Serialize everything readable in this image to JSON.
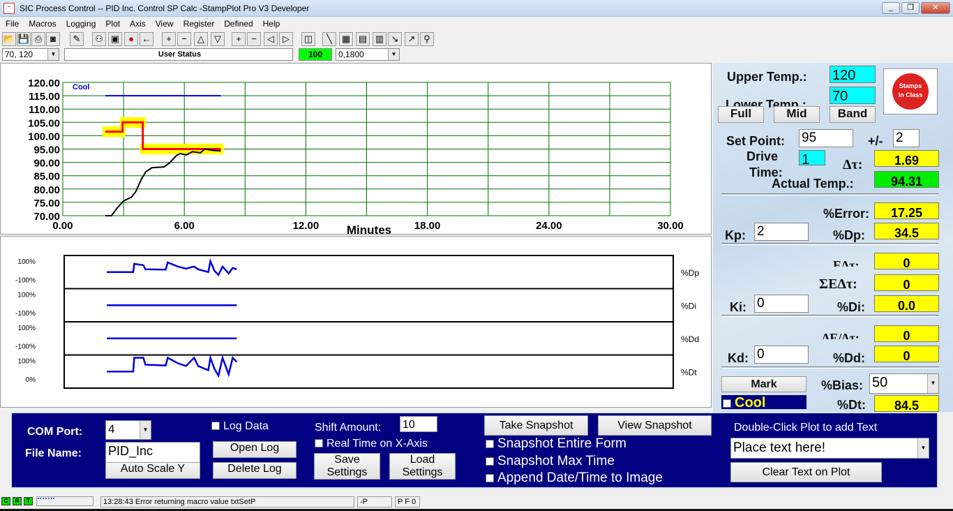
{
  "window": {
    "title": "SIC Process Control -- PID Inc. Control SP Calc -StampPlot Pro V3 Developer"
  },
  "menu": [
    "File",
    "Macros",
    "Logging",
    "Plot",
    "Axis",
    "View",
    "Register",
    "Defined",
    "Help"
  ],
  "toolbar": {
    "icons": [
      "open-icon",
      "save-icon",
      "print-icon",
      "camera-icon",
      "wand-icon",
      "connect-icon",
      "monitor-icon",
      "stop-icon",
      "back-arrow-icon",
      "plus-icon",
      "minus-icon",
      "up-icon",
      "down-icon",
      "plus-icon",
      "minus-icon",
      "left-icon",
      "right-icon",
      "clock-icon",
      "pen-icon",
      "chart-icon",
      "note-icon",
      "calc-icon",
      "probe-icon",
      "graph-icon",
      "wrench-icon"
    ]
  },
  "controls": {
    "y_range": "70, 120",
    "user_status": "User Status",
    "value_indicator": "100",
    "x_range": "0,1800"
  },
  "chart_data": [
    {
      "type": "line",
      "x_label": "Minutes",
      "xlim": [
        0,
        30
      ],
      "ylim": [
        70,
        120
      ],
      "x_ticks": [
        "0.00",
        "6.00",
        "12.00",
        "18.00",
        "24.00",
        "30.00"
      ],
      "y_ticks": [
        "70.00",
        "75.00",
        "80.00",
        "85.00",
        "90.00",
        "95.00",
        "100.00",
        "105.00",
        "110.00",
        "115.00",
        "120.00"
      ],
      "grid": true,
      "annotation": "Cool",
      "series": [
        {
          "color": "#0000dd",
          "points": [
            [
              2.1,
              115
            ],
            [
              7.8,
              115
            ]
          ]
        },
        {
          "color": "#ffff00",
          "band": 2,
          "points": [
            [
              2.1,
              101.5
            ],
            [
              2.95,
              101.5
            ],
            [
              2.95,
              105
            ],
            [
              3.95,
              105
            ],
            [
              3.95,
              95
            ],
            [
              7.8,
              95
            ]
          ]
        },
        {
          "color": "#ff0000",
          "points": [
            [
              2.1,
              101.5
            ],
            [
              2.95,
              101.5
            ],
            [
              2.95,
              105
            ],
            [
              3.95,
              105
            ],
            [
              3.95,
              95
            ],
            [
              7.8,
              95
            ]
          ]
        },
        {
          "color": "#000000",
          "points": [
            [
              2.1,
              70
            ],
            [
              2.4,
              70
            ],
            [
              2.7,
              73
            ],
            [
              3.0,
              75.5
            ],
            [
              3.4,
              77
            ],
            [
              3.6,
              79
            ],
            [
              3.9,
              84
            ],
            [
              4.1,
              86.5
            ],
            [
              4.4,
              88
            ],
            [
              5.0,
              88.3
            ],
            [
              5.3,
              90
            ],
            [
              5.6,
              92.5
            ],
            [
              5.8,
              93.3
            ],
            [
              6.1,
              92.8
            ],
            [
              6.4,
              94
            ],
            [
              6.8,
              93.6
            ],
            [
              7.0,
              95
            ],
            [
              7.4,
              94.5
            ],
            [
              7.8,
              94.3
            ]
          ]
        }
      ]
    },
    {
      "type": "line",
      "strips": [
        {
          "name": "%Dp",
          "top_label": "100%",
          "bottom_label": "-100%",
          "ylim": [
            -100,
            100
          ],
          "points": [
            [
              2.1,
              0
            ],
            [
              3.4,
              0
            ],
            [
              3.45,
              60
            ],
            [
              3.9,
              50
            ],
            [
              4.0,
              20
            ],
            [
              5.0,
              18
            ],
            [
              5.1,
              70
            ],
            [
              5.6,
              40
            ],
            [
              6.0,
              25
            ],
            [
              6.4,
              40
            ],
            [
              6.6,
              20
            ],
            [
              7.1,
              0
            ],
            [
              7.2,
              80
            ],
            [
              7.4,
              10
            ],
            [
              7.6,
              -20
            ],
            [
              7.8,
              40
            ],
            [
              8.1,
              -10
            ],
            [
              8.3,
              30
            ],
            [
              8.5,
              20
            ]
          ]
        },
        {
          "name": "%Di",
          "top_label": "100%",
          "bottom_label": "-100%",
          "ylim": [
            -100,
            100
          ],
          "points": [
            [
              2.1,
              0
            ],
            [
              8.5,
              0
            ]
          ]
        },
        {
          "name": "%Dd",
          "top_label": "100%",
          "bottom_label": "-100%",
          "ylim": [
            -100,
            100
          ],
          "points": [
            [
              2.1,
              0
            ],
            [
              8.5,
              0
            ]
          ]
        },
        {
          "name": "%Dt",
          "top_label": "100%",
          "bottom_label": "0%",
          "ylim": [
            0,
            100
          ],
          "points": [
            [
              2.1,
              50
            ],
            [
              3.4,
              50
            ],
            [
              3.45,
              100
            ],
            [
              3.9,
              100
            ],
            [
              4.0,
              75
            ],
            [
              5.0,
              72
            ],
            [
              5.1,
              100
            ],
            [
              5.6,
              80
            ],
            [
              6.0,
              70
            ],
            [
              6.4,
              100
            ],
            [
              6.6,
              70
            ],
            [
              7.1,
              55
            ],
            [
              7.2,
              100
            ],
            [
              7.4,
              60
            ],
            [
              7.6,
              35
            ],
            [
              7.8,
              100
            ],
            [
              8.1,
              40
            ],
            [
              8.3,
              100
            ],
            [
              8.5,
              85
            ]
          ]
        }
      ]
    }
  ],
  "right_panel": {
    "upper_temp_label": "Upper Temp.:",
    "upper_temp": "120",
    "lower_temp_label": "Lower Temp.:",
    "lower_temp": "70",
    "logo_text": "Stamps in Class",
    "full": "Full",
    "mid": "Mid",
    "band": "Band",
    "set_point_label": "Set Point:",
    "set_point": "95",
    "pm_label": "+/-",
    "pm": "2",
    "drive_time_label1": "Drive",
    "drive_time_label2": "Time:",
    "drive_time": "1",
    "dt_label": "Δτ:",
    "dt": "1.69",
    "actual_label": "Actual Temp.:",
    "actual": "94.31",
    "error_label": "%Error:",
    "error": "17.25",
    "kp_label": "Kp:",
    "kp": "2",
    "dp_label": "%Dp:",
    "dp": "34.5",
    "edt_label": "EΔτ:",
    "edt": "0",
    "sedt_label": "ΣEΔτ:",
    "sedt": "0",
    "ki_label": "Ki:",
    "ki": "0",
    "di_label": "%Di:",
    "di": "0.0",
    "dedt_label": "ΔE/Δτ:",
    "dedt": "0",
    "kd_label": "Kd:",
    "kd": "0",
    "dd_label": "%Dd:",
    "dd": "0",
    "mark": "Mark",
    "bias_label": "%Bias:",
    "bias": "50",
    "cool_label": "Cool",
    "dtot_label": "%Dt:",
    "dtot": "84.5"
  },
  "bottom": {
    "com_label": "COM Port:",
    "com": "4",
    "file_label": "File Name:",
    "file": "PID_Inc",
    "auto_scale": "Auto Scale Y",
    "log_data": "Log Data",
    "open_log": "Open Log",
    "delete_log": "Delete Log",
    "shift_label": "Shift Amount:",
    "shift": "10",
    "real_time": "Real Time on X-Axis",
    "save1": "Save",
    "save2": "Settings",
    "load1": "Load",
    "load2": "Settings",
    "take_snap": "Take Snapshot",
    "view_snap": "View Snapshot",
    "snap_entire": "Snapshot Entire Form",
    "snap_max": "Snapshot Max Time",
    "append_dt": "Append Date/Time to Image",
    "dbl_click": "Double-Click Plot to add Text",
    "place_text": "Place text here!",
    "clear_text": "Clear Text on Plot"
  },
  "status": {
    "c": "C",
    "r": "R",
    "t": "T",
    "message": "13:28:43 Error returning macro value txtSetP",
    "p1": "-P",
    "p2": "P F 0"
  }
}
